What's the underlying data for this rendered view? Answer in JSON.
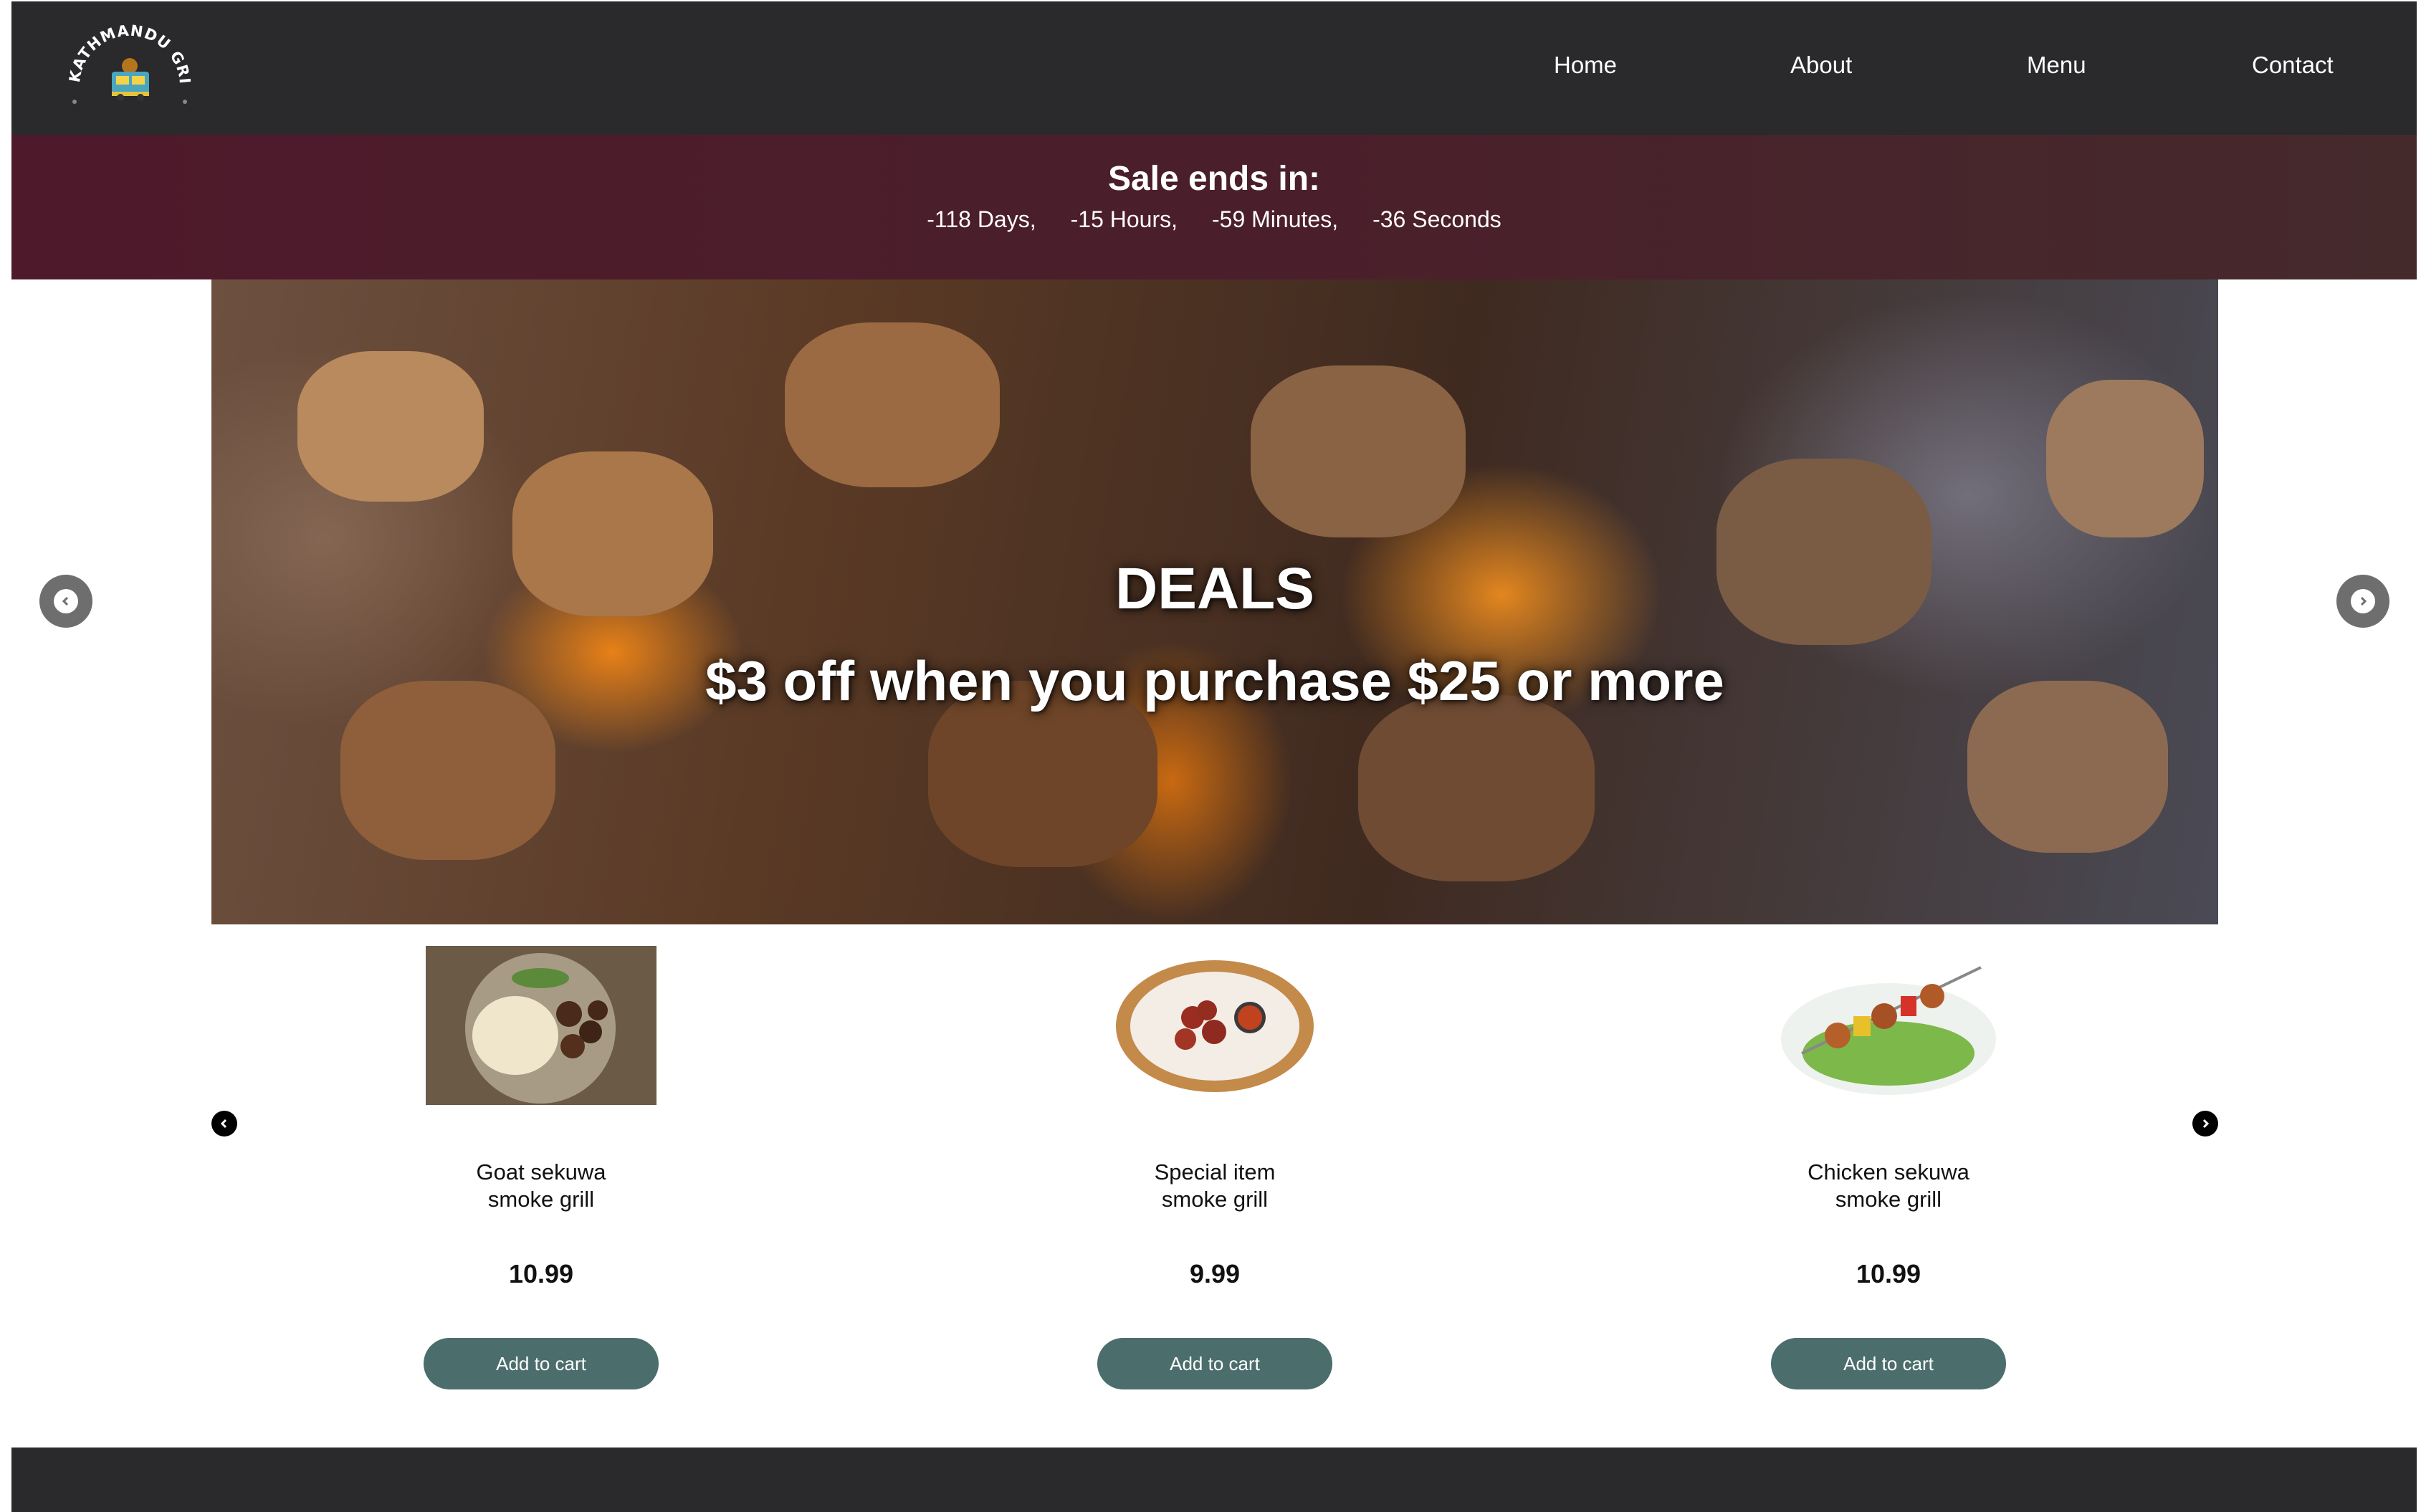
{
  "brand": {
    "logo_text": "KATHMANDU GRILLS"
  },
  "nav": {
    "items": [
      {
        "label": "Home"
      },
      {
        "label": "About"
      },
      {
        "label": "Menu"
      },
      {
        "label": "Contact"
      }
    ]
  },
  "sale": {
    "title": "Sale ends in:",
    "days": "-118 Days,",
    "hours": "-15 Hours,",
    "minutes": "-59 Minutes,",
    "seconds": "-36 Seconds"
  },
  "hero": {
    "title": "DEALS",
    "subtitle": "$3 off when you purchase $25 or more",
    "prev_icon": "chevron-left-icon",
    "next_icon": "chevron-right-icon"
  },
  "products": [
    {
      "name": "Goat sekuwa\nsmoke grill",
      "price": "10.99",
      "button": "Add to cart"
    },
    {
      "name": "Special item\nsmoke grill",
      "price": "9.99",
      "button": "Add to cart"
    },
    {
      "name": "Chicken sekuwa\nsmoke grill",
      "price": "10.99",
      "button": "Add to cart"
    }
  ],
  "colors": {
    "navbar": "#2a292b",
    "sale_banner": "#4e1a2b",
    "button": "#4b6e6d",
    "footer": "#2a292b"
  }
}
